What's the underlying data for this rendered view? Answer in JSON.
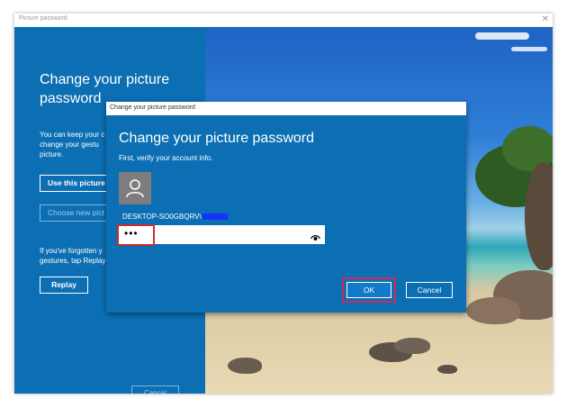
{
  "window": {
    "title": "Picture password",
    "close_glyph": "✕"
  },
  "left_pane": {
    "heading": "Change your picture password",
    "description": "You can keep your c\nchange your gestu\npicture.",
    "use_picture_button": "Use this picture",
    "choose_picture_button": "Choose new pict",
    "forgot_text": "If you've forgotten y\ngestures, tap Replay",
    "replay_button": "Replay",
    "cancel_button": "Cancel"
  },
  "dialog": {
    "title": "Change your picture password",
    "heading": "Change your picture password",
    "subtitle": "First, verify your account info.",
    "account_name": "DESKTOP-SO0GBQRV\\",
    "password_value": "•••",
    "ok_button": "OK",
    "cancel_button": "Cancel"
  },
  "icons": {
    "avatar": "user-icon",
    "reveal": "eye-icon",
    "close": "close-icon"
  },
  "colors": {
    "accent_blue": "#0c6fb3",
    "highlight_red": "#d12a2a",
    "redaction_blue": "#1433ff"
  }
}
